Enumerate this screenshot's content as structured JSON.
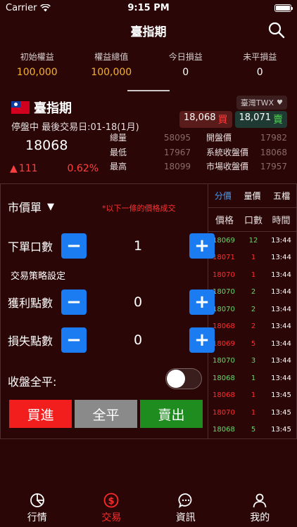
{
  "status_bar": {
    "carrier": "Carrier",
    "time": "9:15 PM"
  },
  "nav": {
    "title": "臺指期",
    "search_icon": "search-icon"
  },
  "summary": [
    {
      "label": "初始權益",
      "value": "100,000"
    },
    {
      "label": "權益總值",
      "value": "100,000"
    },
    {
      "label": "今日損益",
      "value": "0"
    },
    {
      "label": "未平損益",
      "value": "0"
    }
  ],
  "quote": {
    "name": "臺指期",
    "status": "停盤中 最後交易日:01-18(1月)",
    "exchange": "臺灣TWX",
    "bid": "18,068",
    "bid_tag": "買",
    "ask": "18,071",
    "ask_tag": "賣",
    "last_price": "18068",
    "change": "111",
    "change_pct": "0.62%",
    "stats": [
      {
        "k": "總量",
        "v": "58095"
      },
      {
        "k": "開盤價",
        "v": "17982"
      },
      {
        "k": "最低",
        "v": "17967"
      },
      {
        "k": "系統收盤價",
        "v": "18068"
      },
      {
        "k": "最高",
        "v": "18099"
      },
      {
        "k": "市場收盤價",
        "v": "17957"
      }
    ]
  },
  "order": {
    "order_type": "市價單",
    "price_note": "*以下一條的價格成交",
    "qty_label": "下單口數",
    "qty_value": "1",
    "strategy_label": "交易策略設定",
    "tp_label": "獲利點數",
    "tp_value": "0",
    "sl_label": "損失點數",
    "sl_value": "0",
    "close_all_label": "收盤全平:",
    "close_all_on": false,
    "minus": "−",
    "plus": "+",
    "buy_label": "買進",
    "flat_label": "全平",
    "sell_label": "賣出"
  },
  "ticks": {
    "tabs": [
      "分價",
      "量價",
      "五檔"
    ],
    "active_tab": 0,
    "headers": {
      "price": "價格",
      "qty": "口數",
      "time": "時間"
    },
    "rows": [
      {
        "price": "18069",
        "qty": "12",
        "time": "13:44",
        "dir": "up"
      },
      {
        "price": "18071",
        "qty": "1",
        "time": "13:44",
        "dir": "down"
      },
      {
        "price": "18070",
        "qty": "1",
        "time": "13:44",
        "dir": "down"
      },
      {
        "price": "18070",
        "qty": "2",
        "time": "13:44",
        "dir": "up"
      },
      {
        "price": "18070",
        "qty": "2",
        "time": "13:44",
        "dir": "up"
      },
      {
        "price": "18068",
        "qty": "2",
        "time": "13:44",
        "dir": "down"
      },
      {
        "price": "18069",
        "qty": "5",
        "time": "13:44",
        "dir": "down"
      },
      {
        "price": "18070",
        "qty": "3",
        "time": "13:44",
        "dir": "up"
      },
      {
        "price": "18068",
        "qty": "1",
        "time": "13:44",
        "dir": "up"
      },
      {
        "price": "18068",
        "qty": "1",
        "time": "13:45",
        "dir": "down"
      },
      {
        "price": "18070",
        "qty": "1",
        "time": "13:45",
        "dir": "down"
      },
      {
        "price": "18068",
        "qty": "5",
        "time": "13:45",
        "dir": "up"
      }
    ]
  },
  "tabbar": [
    {
      "label": "行情",
      "icon": "pie-chart-icon"
    },
    {
      "label": "交易",
      "icon": "dollar-circle-icon"
    },
    {
      "label": "資訊",
      "icon": "chat-bubble-icon"
    },
    {
      "label": "我的",
      "icon": "person-icon"
    }
  ],
  "colors": {
    "accent": "#1a7cf0",
    "up": "#6bd86b",
    "down": "#ff3030",
    "gold": "#f4b232",
    "active_tab": "#ff2a2a"
  }
}
